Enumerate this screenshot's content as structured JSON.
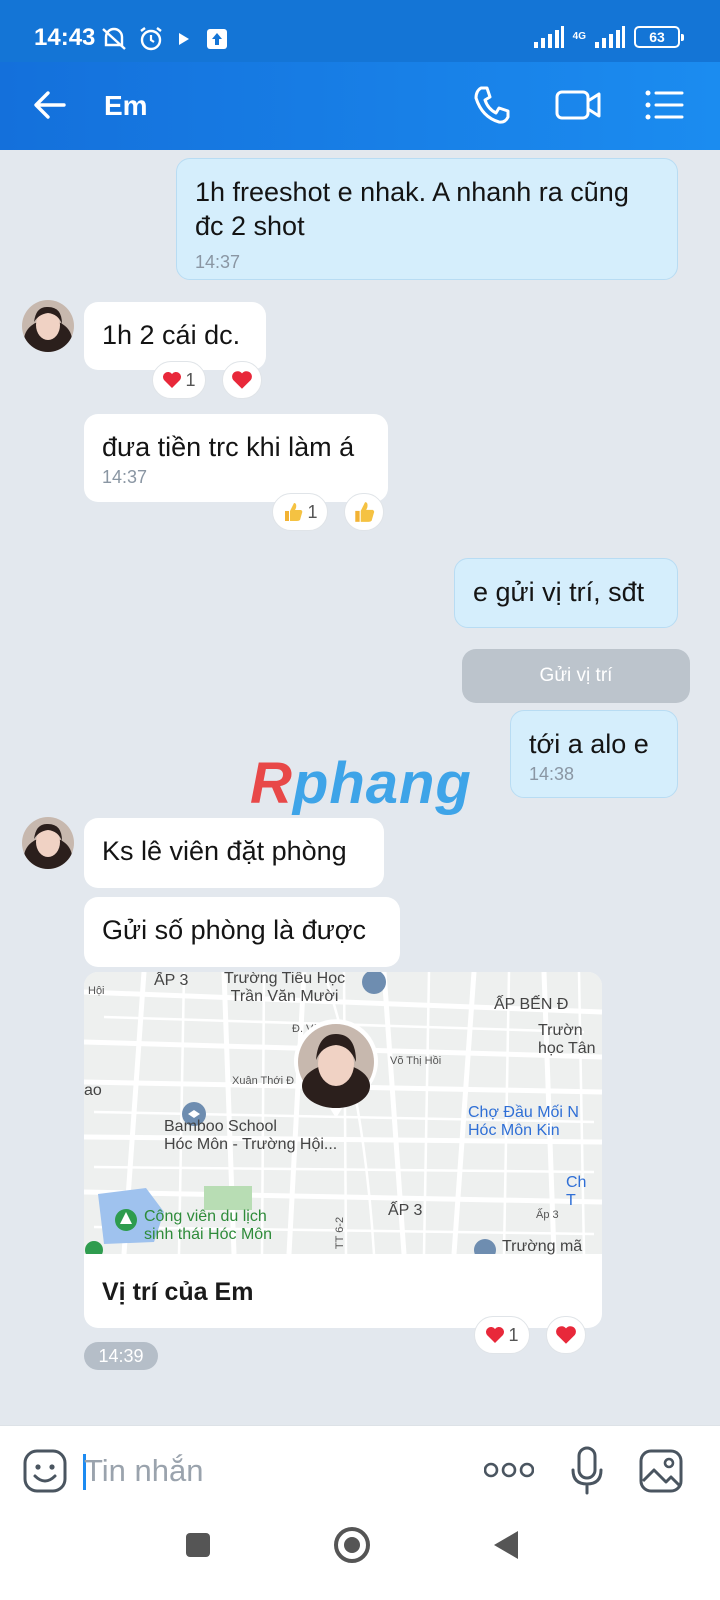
{
  "status_bar": {
    "time": "14:43",
    "network": "4G",
    "battery": "63"
  },
  "header": {
    "title": "Em",
    "icons": [
      "back-arrow-icon",
      "phone-icon",
      "video-camera-icon",
      "menu-list-icon"
    ]
  },
  "messages": [
    {
      "id": "m1",
      "direction": "out",
      "text": "1h freeshot e nhak. A nhanh ra cũng đc 2 shot",
      "time": "14:37"
    },
    {
      "id": "m2",
      "direction": "in",
      "text": "1h 2 cái dc.",
      "reactions": {
        "emoji": "heart",
        "count": "1"
      }
    },
    {
      "id": "m3",
      "direction": "in",
      "text": "đưa tiền trc khi làm á",
      "time": "14:37",
      "reactions": {
        "emoji": "thumbs-up",
        "count": "1"
      }
    },
    {
      "id": "m4",
      "direction": "out",
      "text": "e gửi vị trí, sđt"
    },
    {
      "id": "m5",
      "direction": "system",
      "text": "Gửi vị trí"
    },
    {
      "id": "m6",
      "direction": "out",
      "text": "tới a alo e",
      "time": "14:38"
    },
    {
      "id": "m7",
      "direction": "in",
      "text": "Ks lê viên đặt phòng"
    },
    {
      "id": "m8",
      "direction": "in",
      "text": "Gửi số phòng là được"
    },
    {
      "id": "m9",
      "direction": "in",
      "type": "location",
      "caption": "Vị trí của Em",
      "time": "14:39",
      "reactions": {
        "emoji": "heart",
        "count": "1"
      }
    }
  ],
  "watermark": {
    "part1": "R",
    "part2": "phang"
  },
  "map": {
    "labels": {
      "ap3_top": "ẤP 3",
      "hoi_left": "Hội",
      "school": "Trường Tiểu Học\nTrần Văn Mười",
      "ap_ben": "ẤP BẾN Đ",
      "truong_tan": "Trườn\nhọc Tân",
      "vo_t": "Đ. Võ T",
      "vo_thi_hoi": "Võ Thị Hồi",
      "xuan_thoi": "Xuân Thới Đ",
      "ao": "ao",
      "bamboo": "Bamboo School\nHóc Môn - Trường Hội...",
      "cho_dau_moi": "Chợ Đầu Mối N\nHóc Môn Kin",
      "ch_right": "Ch\nT",
      "park": "Công viên du lịch\nsinh thái Hóc Môn",
      "ap3_mid": "ẤP 3",
      "ap3_small": "Ấp 3",
      "tt62": "TT 6-2",
      "truong_ma": "Trường mã"
    }
  },
  "input": {
    "placeholder": "Tin nhắn"
  },
  "accent_color": "#1b7ce8"
}
